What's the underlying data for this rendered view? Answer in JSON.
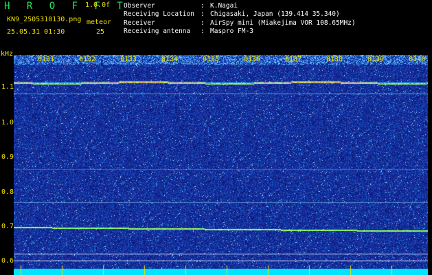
{
  "header": {
    "app_name": "H R O F F T",
    "version": "1.0.0f",
    "filename": "KN9_2505310130.png",
    "datetime": "25.05.31 01:30",
    "meteor_label": "meteor",
    "meteor_count": "25"
  },
  "info": {
    "observer_label": "Observer",
    "observer_value": "K.Nagai",
    "location_label": "Receiving Location",
    "location_value": "Chigasaki, Japan (139.414 35.340)",
    "receiver_label": "Receiver",
    "receiver_value": "AirSpy mini (Miakejima VOR 108.65MHz)",
    "antenna_label": "Receiving antenna",
    "antenna_value": "Maspro FM-3",
    "separator": ":"
  },
  "axes": {
    "unit": "kHz",
    "y_ticks": [
      "1.1",
      "1.0",
      "0.9",
      "0.8",
      "0.7",
      "0.6"
    ],
    "x_ticks": [
      "0131",
      "0132",
      "0133",
      "0134",
      "0135",
      "0136",
      "0137",
      "0138",
      "0139",
      "0140"
    ]
  },
  "colors": {
    "label": "#f0e000",
    "brand": "#1ee85a",
    "background_noise": "#1a2f9a",
    "carrier": "#ff3070",
    "bottom_band": "#00e5ff"
  }
}
